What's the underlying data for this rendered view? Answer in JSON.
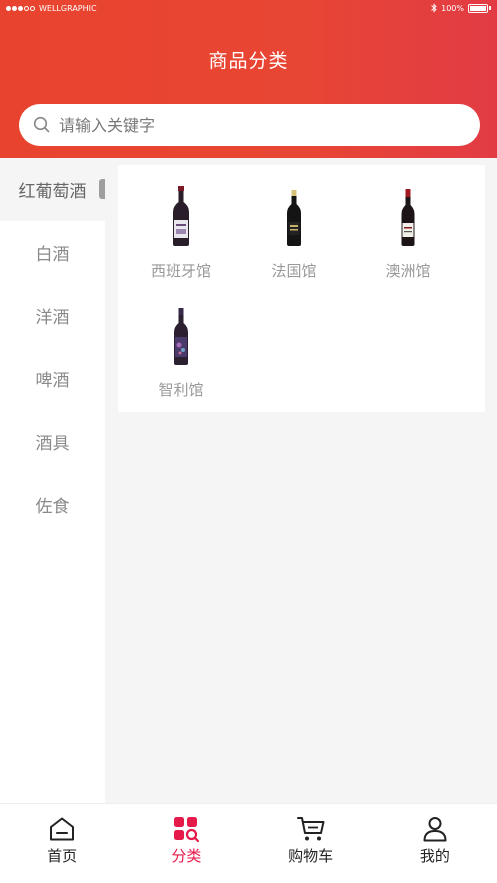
{
  "status_bar": {
    "carrier": "WELLGRAPHIC",
    "battery": "100%"
  },
  "header": {
    "title": "商品分类"
  },
  "search": {
    "placeholder": "请输入关键字",
    "icon": "search-icon"
  },
  "sidebar": {
    "items": [
      {
        "label": "红葡萄酒",
        "active": true
      },
      {
        "label": "白酒"
      },
      {
        "label": "洋酒"
      },
      {
        "label": "啤酒"
      },
      {
        "label": "酒具"
      },
      {
        "label": "佐食"
      }
    ]
  },
  "subcategories": [
    {
      "label": "西班牙馆",
      "icon": "wine-bottle-icon"
    },
    {
      "label": "法国馆",
      "icon": "wine-bottle-icon"
    },
    {
      "label": "澳洲馆",
      "icon": "wine-bottle-icon"
    },
    {
      "label": "智利馆",
      "icon": "wine-bottle-icon"
    }
  ],
  "tabbar": {
    "tabs": [
      {
        "label": "首页",
        "icon": "home-icon"
      },
      {
        "label": "分类",
        "icon": "category-search-icon",
        "active": true
      },
      {
        "label": "购物车",
        "icon": "cart-icon"
      },
      {
        "label": "我的",
        "icon": "user-icon"
      }
    ]
  },
  "colors": {
    "brand": "#e8432e",
    "active_tab": "#e5194a"
  }
}
